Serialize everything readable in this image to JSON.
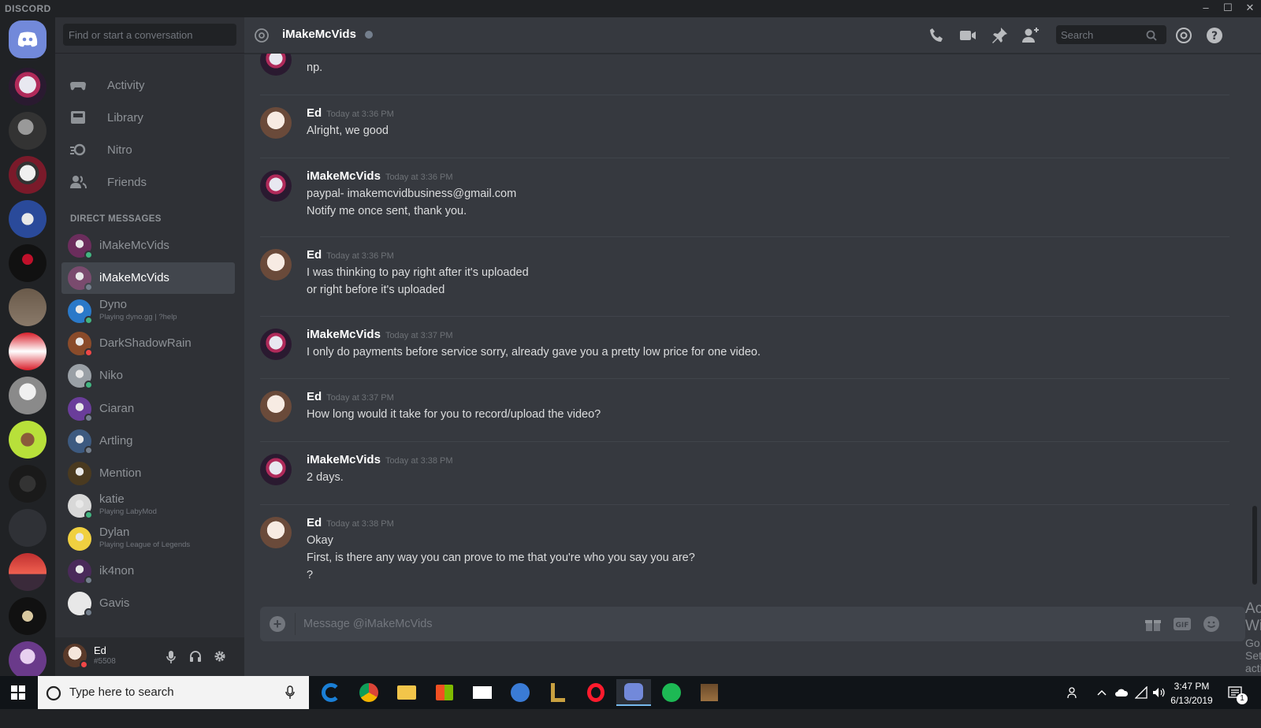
{
  "window": {
    "brand": "DISCORD",
    "minimize": "–",
    "maximize": "☐",
    "close": "✕"
  },
  "dm_panel": {
    "search_placeholder": "Find or start a conversation",
    "nav": [
      {
        "label": "Activity",
        "icon": "gamepad-icon"
      },
      {
        "label": "Library",
        "icon": "library-icon"
      },
      {
        "label": "Nitro",
        "icon": "nitro-icon"
      },
      {
        "label": "Friends",
        "icon": "friends-icon"
      }
    ],
    "section_title": "DIRECT MESSAGES",
    "dms": [
      {
        "name": "iMakeMcVids",
        "sub": "",
        "status": "online",
        "color": "#6b2d5c"
      },
      {
        "name": "iMakeMcVids",
        "sub": "",
        "status": "offline",
        "color": "#7a4b6e",
        "active": true
      },
      {
        "name": "Dyno",
        "sub": "Playing dyno.gg | ?help",
        "status": "online",
        "color": "#2a79c9"
      },
      {
        "name": "DarkShadowRain",
        "sub": "",
        "status": "dnd",
        "color": "#8a4b2a"
      },
      {
        "name": "Niko",
        "sub": "",
        "status": "online",
        "color": "#9aa0a6"
      },
      {
        "name": "Ciaran",
        "sub": "",
        "status": "offline",
        "color": "#6a3d9a"
      },
      {
        "name": "Artling",
        "sub": "",
        "status": "offline",
        "color": "#3d5a80"
      },
      {
        "name": "Mention",
        "sub": "",
        "status": "none",
        "color": "#4a3a20"
      },
      {
        "name": "katie",
        "sub": "Playing LabyMod",
        "status": "online",
        "color": "#d8d8d8"
      },
      {
        "name": "Dylan",
        "sub": "Playing League of Legends",
        "status": "none",
        "color": "#f0d040"
      },
      {
        "name": "ik4non",
        "sub": "",
        "status": "offline",
        "color": "#4a2a5a"
      },
      {
        "name": "Gavis",
        "sub": "",
        "status": "offline",
        "color": "#e8e8e8"
      }
    ],
    "user": {
      "name": "Ed",
      "tag": "#5508"
    }
  },
  "chat": {
    "channel": "iMakeMcVids",
    "search_placeholder": "Search",
    "input_placeholder": "Message @iMakeMcVids",
    "messages": [
      {
        "author": "",
        "time": "",
        "lines": [
          "np."
        ],
        "who": "mcvids"
      },
      {
        "author": "Ed",
        "time": "Today at 3:36 PM",
        "lines": [
          "Alright, we good"
        ],
        "who": "ed"
      },
      {
        "author": "iMakeMcVids",
        "time": "Today at 3:36 PM",
        "lines": [
          "paypal- imakemcvidbusiness@gmail.com",
          "Notify me once sent, thank you."
        ],
        "who": "mcvids"
      },
      {
        "author": "Ed",
        "time": "Today at 3:36 PM",
        "lines": [
          "I was thinking to pay right after it's uploaded",
          "or right before it's uploaded"
        ],
        "who": "ed"
      },
      {
        "author": "iMakeMcVids",
        "time": "Today at 3:37 PM",
        "lines": [
          "I only do payments before service sorry, already gave you a pretty low price for one video."
        ],
        "who": "mcvids"
      },
      {
        "author": "Ed",
        "time": "Today at 3:37 PM",
        "lines": [
          "How long would it take for you to record/upload the video?"
        ],
        "who": "ed"
      },
      {
        "author": "iMakeMcVids",
        "time": "Today at 3:38 PM",
        "lines": [
          "2 days."
        ],
        "who": "mcvids"
      },
      {
        "author": "Ed",
        "time": "Today at 3:38 PM",
        "lines": [
          "Okay",
          "First, is there any way you can prove to me that you're who you say you are?",
          "?"
        ],
        "who": "ed"
      }
    ]
  },
  "watermark": {
    "line1": "Activate Windows",
    "line2": "Go to Settings to activate Windows."
  },
  "taskbar": {
    "search_placeholder": "Type here to search",
    "time": "3:47 PM",
    "date": "6/13/2019",
    "notification_count": "1"
  },
  "colors": {
    "accent": "#7289da",
    "online": "#43b581",
    "dnd": "#f04747",
    "offline": "#747f8d"
  }
}
